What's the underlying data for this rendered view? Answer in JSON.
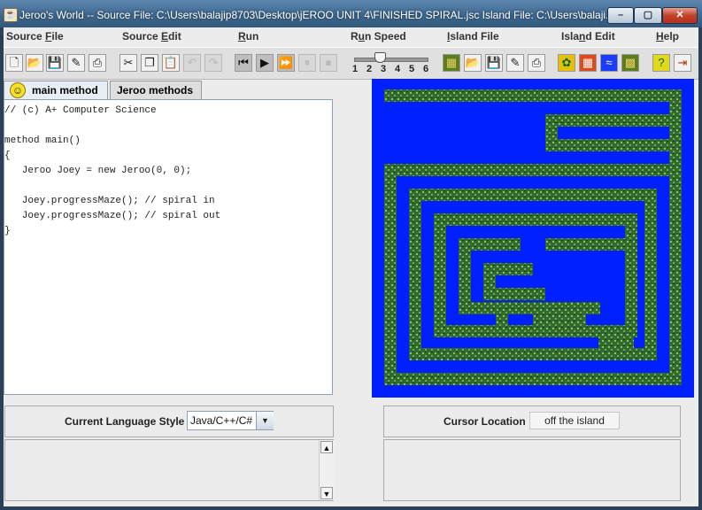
{
  "window": {
    "title": "Jeroo's World -- Source File: C:\\Users\\balajip8703\\Desktop\\jEROO UNIT 4\\FINISHED SPIRAL.jsc    Island File: C:\\Users\\balaji...",
    "min_glyph": "–",
    "max_glyph": "▢",
    "close_glyph": "✕"
  },
  "menu": {
    "source_file": {
      "pre": "Source ",
      "key": "F",
      "post": "ile"
    },
    "source_edit": {
      "pre": "Source ",
      "key": "E",
      "post": "dit"
    },
    "run": {
      "pre": "",
      "key": "R",
      "post": "un"
    },
    "run_speed": {
      "pre": "R",
      "key": "u",
      "post": "n Speed"
    },
    "island_file": {
      "pre": "",
      "key": "I",
      "post": "sland File"
    },
    "island_edit": {
      "pre": "Isla",
      "key": "n",
      "post": "d Edit"
    },
    "help": {
      "pre": "",
      "key": "H",
      "post": "elp"
    }
  },
  "toolbar": {
    "speed_ticks": [
      "1",
      "2",
      "3",
      "4",
      "5",
      "6"
    ],
    "speed_value": 3
  },
  "tabs": {
    "main": "main method",
    "jeroo": "Jeroo methods"
  },
  "editor": {
    "code": "// (c) A+ Computer Science\n\nmethod main()\n{\n   Jeroo Joey = new Jeroo(0, 0);\n\n   Joey.progressMaze(); // spiral in\n   Joey.progressMaze(); // spiral out\n}"
  },
  "language": {
    "label": "Current Language Style",
    "value": "Java/C++/C#"
  },
  "cursor": {
    "label": "Cursor Location",
    "value": "off the island"
  },
  "colors": {
    "water": "#0020ff",
    "net": "#2f6a2f"
  }
}
